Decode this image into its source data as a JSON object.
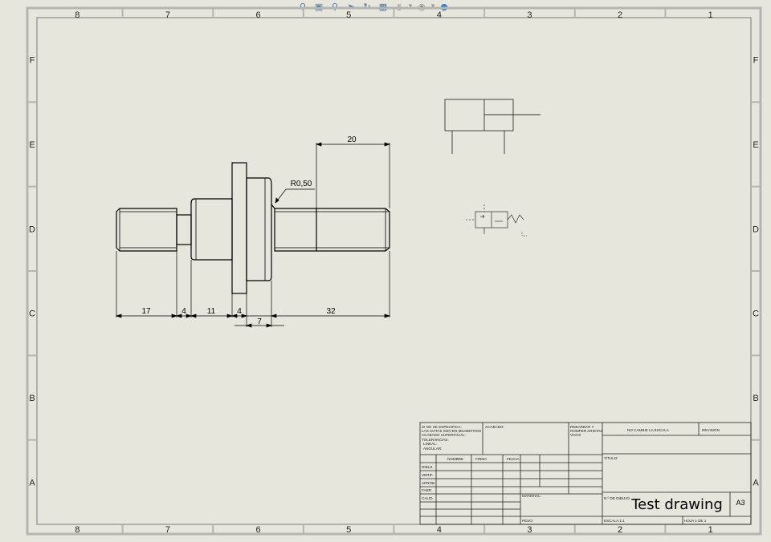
{
  "zone_cols": [
    "8",
    "7",
    "6",
    "5",
    "4",
    "3",
    "2",
    "1"
  ],
  "zone_rows": [
    "F",
    "E",
    "D",
    "C",
    "B",
    "A"
  ],
  "toolbar": {
    "icons": [
      "zoom-to-fit-icon",
      "zoom-area-icon",
      "zoom-in-out-icon",
      "select-icon",
      "rotate-icon",
      "view-orientation-icon",
      "display-style-icon",
      "hide-show-icon",
      "appearance-icon"
    ]
  },
  "dimensions": {
    "d20": "20",
    "r050": "R0,50",
    "d17": "17",
    "d4a": "4",
    "d11": "11",
    "d4b": "4",
    "d7": "7",
    "d32": "32"
  },
  "title_block": {
    "notes": [
      "SI NO SE ESPECIFICA:",
      "LAS COTAS SON EN MILIMETROS",
      "ACABADO SUPERFICIAL:",
      "TOLERANCIAS:",
      "  LINEAL:",
      "  ANGULAR:"
    ],
    "acabado": "ACABADO:",
    "rebabas": [
      "REBARBAR Y",
      "ROMPER ARISTAS",
      "VIVAS"
    ],
    "no_escale": "NO CAMBIE LA ESCALA",
    "revision": "REVISIÓN",
    "col_nombre": "NOMBRE",
    "col_firma": "FIRMA",
    "col_fecha": "FECHA",
    "row_labels": [
      "DIBUJ.",
      "VERIF.",
      "APROB.",
      "FABR.",
      "CALID."
    ],
    "titulo": "TÍTULO:",
    "material": "MATERIAL:",
    "n_dibujo": "N.º DE DIBUJO",
    "drawing_name": "Test drawing",
    "size": "A3",
    "peso": "PESO:",
    "escala": "ESCALA:1:1",
    "hoja": "HOJA 1 DE 1"
  }
}
